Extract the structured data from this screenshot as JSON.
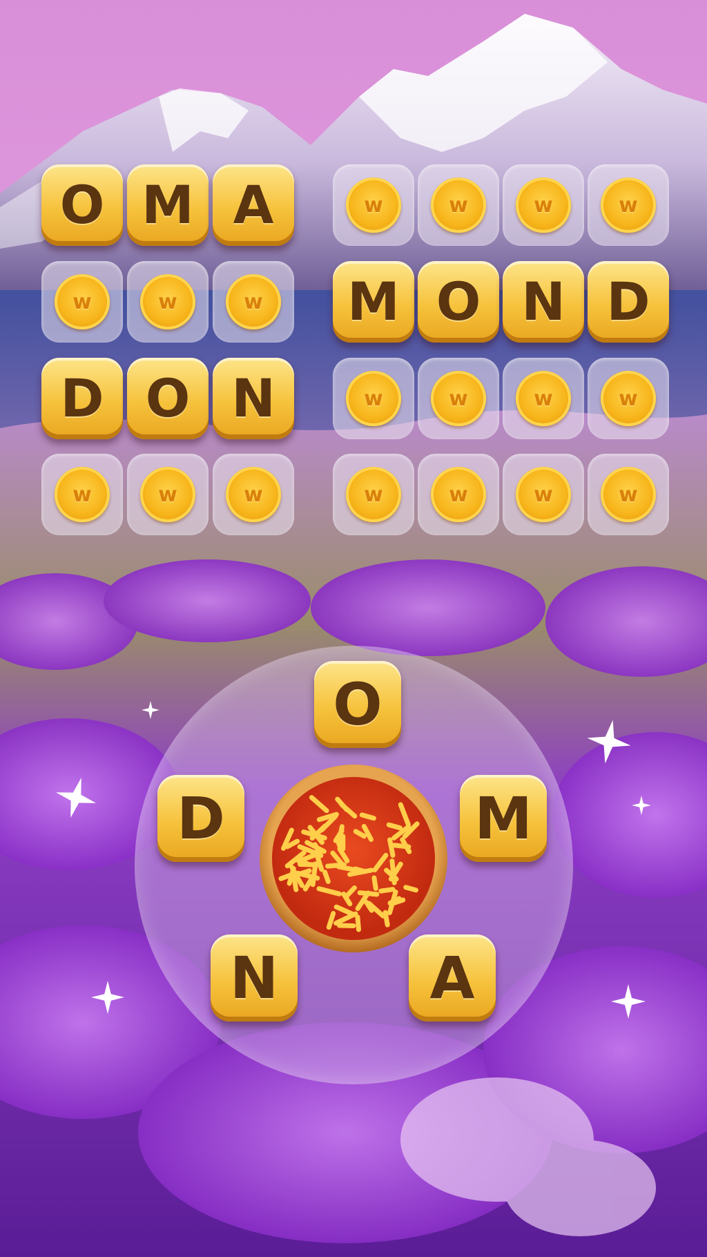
{
  "game": "word puzzle",
  "board": {
    "rows": [
      {
        "left": {
          "letters": [
            "O",
            "M",
            "A"
          ],
          "solved": true
        },
        "right": {
          "letters": [
            "",
            "",
            "",
            ""
          ],
          "solved": false
        }
      },
      {
        "left": {
          "letters": [
            "",
            "",
            ""
          ],
          "solved": false
        },
        "right": {
          "letters": [
            "M",
            "O",
            "N",
            "D"
          ],
          "solved": true
        }
      },
      {
        "left": {
          "letters": [
            "D",
            "O",
            "N"
          ],
          "solved": true
        },
        "right": {
          "letters": [
            "",
            "",
            "",
            ""
          ],
          "solved": false
        }
      },
      {
        "left": {
          "letters": [
            "",
            "",
            ""
          ],
          "solved": false
        },
        "right": {
          "letters": [
            "",
            "",
            "",
            ""
          ],
          "solved": false
        }
      }
    ],
    "coin_label": "w"
  },
  "wheel": {
    "letters": [
      "O",
      "M",
      "A",
      "N",
      "D"
    ],
    "center_icon": "pizza-icon"
  },
  "colors": {
    "tile": "#f6c23c",
    "letter": "#5b3410",
    "coin": "#f7b51b",
    "sky_top": "#e9a1e0",
    "lavender": "#8a2fc8"
  }
}
